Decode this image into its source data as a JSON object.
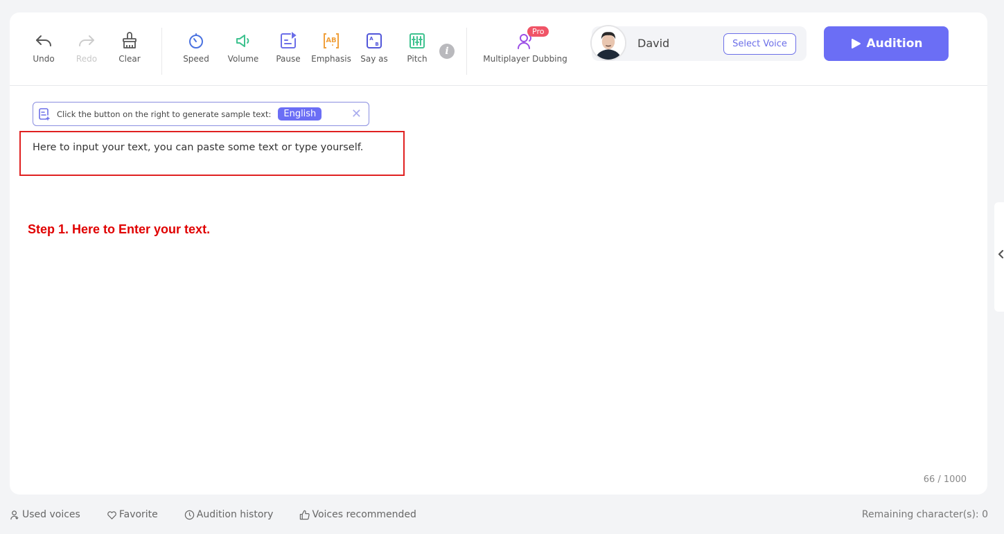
{
  "toolbar": {
    "undo": "Undo",
    "redo": "Redo",
    "clear": "Clear",
    "speed": "Speed",
    "volume": "Volume",
    "pause": "Pause",
    "emphasis": "Emphasis",
    "say_as": "Say as",
    "pitch": "Pitch",
    "info": "i",
    "multiplayer": "Multiplayer Dubbing",
    "pro_badge": "Pro"
  },
  "voice": {
    "name": "David",
    "select_label": "Select Voice"
  },
  "audition": {
    "label": "Audition"
  },
  "sample": {
    "prompt": "Click the button on the right to generate sample text:",
    "language": "English",
    "close": "✕"
  },
  "editor": {
    "text": "Here to input your text, you can paste some text or type yourself.",
    "counter": "66 / 1000"
  },
  "annotation": {
    "step": "Step 1. Here to Enter your text."
  },
  "footer": {
    "used_voices": "Used voices",
    "favorite": "Favorite",
    "audition_history": "Audition history",
    "voices_recommended": "Voices recommended",
    "remaining": "Remaining character(s): 0"
  },
  "colors": {
    "accent": "#6b6ef5",
    "pro": "#f05467",
    "annotation_red": "#e00000"
  }
}
